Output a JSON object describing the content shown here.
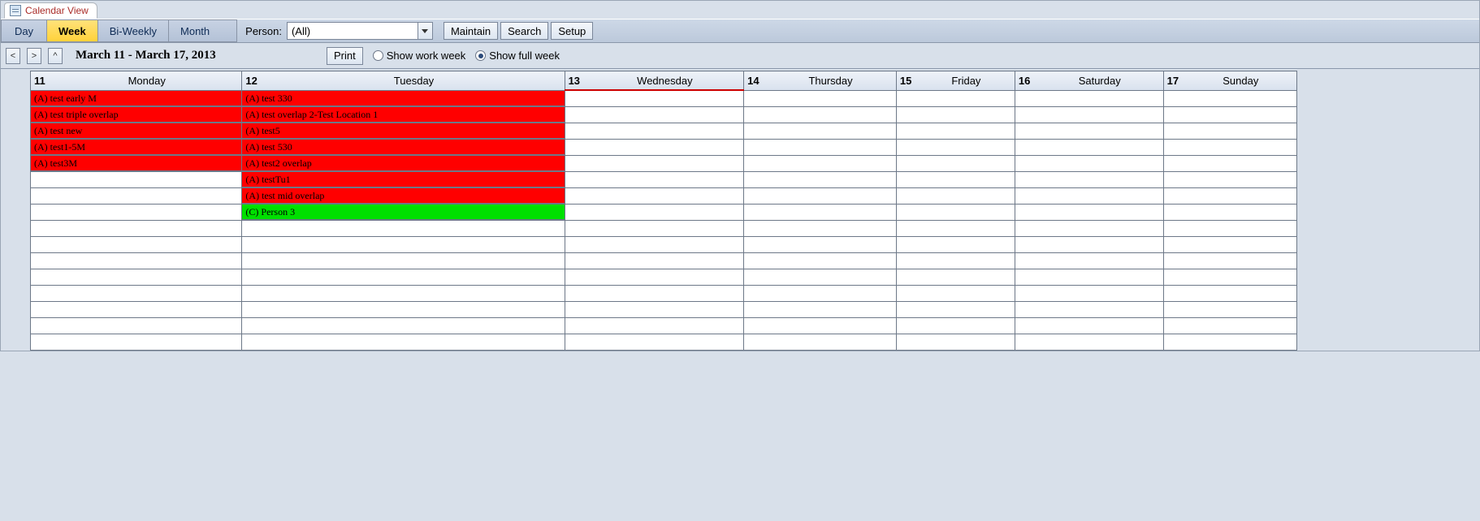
{
  "tab_title": "Calendar View",
  "views": {
    "day": "Day",
    "week": "Week",
    "biweekly": "Bi-Weekly",
    "month": "Month",
    "selected": "week"
  },
  "person": {
    "label": "Person:",
    "value": "(All)"
  },
  "buttons": {
    "maintain": "Maintain",
    "search": "Search",
    "setup": "Setup",
    "print": "Print"
  },
  "nav": {
    "prev": "<",
    "next": ">",
    "up": "^"
  },
  "date_range": "March 11 - March 17, 2013",
  "week_radios": {
    "work": "Show work week",
    "full": "Show full week",
    "selected": "full"
  },
  "days": [
    {
      "num": "11",
      "name": "Monday"
    },
    {
      "num": "12",
      "name": "Tuesday"
    },
    {
      "num": "13",
      "name": "Wednesday"
    },
    {
      "num": "14",
      "name": "Thursday"
    },
    {
      "num": "15",
      "name": "Friday"
    },
    {
      "num": "16",
      "name": "Saturday"
    },
    {
      "num": "17",
      "name": "Sunday"
    }
  ],
  "events": {
    "monday": [
      {
        "text": "(A) test early M",
        "color": "red"
      },
      {
        "text": "(A) test triple overlap",
        "color": "red"
      },
      {
        "text": "(A) test new",
        "color": "red"
      },
      {
        "text": "(A) test1-5M",
        "color": "red"
      },
      {
        "text": "(A) test3M",
        "color": "red"
      }
    ],
    "tuesday": [
      {
        "text": "(A) test 330",
        "color": "red"
      },
      {
        "text": "(A) test overlap 2-Test Location 1",
        "color": "red"
      },
      {
        "text": "(A) test5",
        "color": "red"
      },
      {
        "text": "(A) test 530",
        "color": "red"
      },
      {
        "text": "(A) test2 overlap",
        "color": "red"
      },
      {
        "text": "(A) testTu1",
        "color": "red"
      },
      {
        "text": "(A) test mid overlap",
        "color": "red"
      },
      {
        "text": "(C) Person 3",
        "color": "green"
      }
    ],
    "wednesday": [],
    "thursday": [],
    "friday": [],
    "saturday": [],
    "sunday": []
  },
  "row_count": 16
}
